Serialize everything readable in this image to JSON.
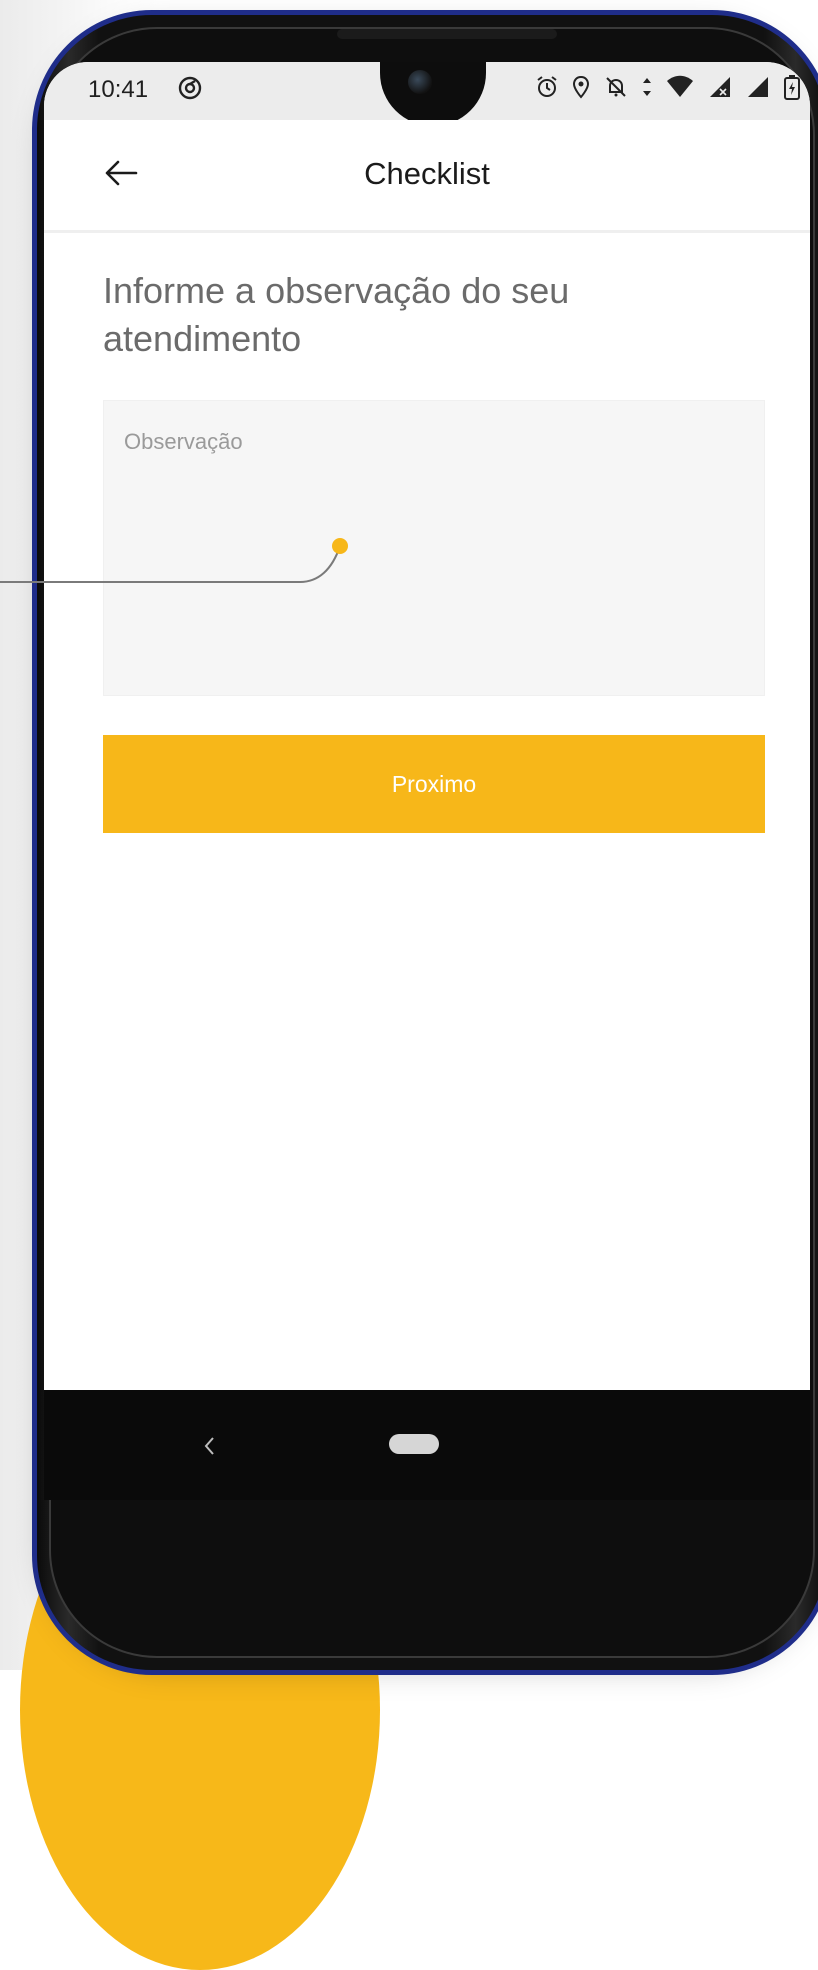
{
  "status_bar": {
    "time": "10:41",
    "icons": [
      "sync-icon",
      "alarm-icon",
      "location-icon",
      "notifications-off-icon",
      "data-arrows-icon",
      "wifi-icon",
      "signal-icon",
      "signal-icon",
      "battery-icon"
    ]
  },
  "app_bar": {
    "back_icon": "arrow-left-icon",
    "title": "Checklist"
  },
  "main": {
    "heading": "Informe a observação do seu atendimento",
    "observation_field": {
      "placeholder": "Observação",
      "value": ""
    },
    "next_button_label": "Proximo"
  },
  "colors": {
    "accent": "#f7b719",
    "frame_blue": "#1f2d8a",
    "heading_text": "#6b6b6b"
  }
}
